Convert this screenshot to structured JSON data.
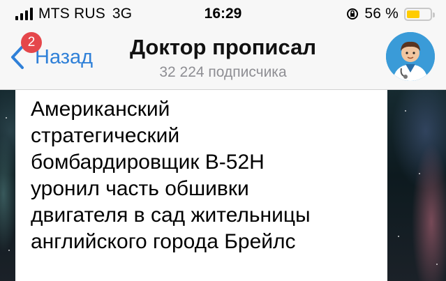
{
  "status_bar": {
    "carrier": "MTS RUS",
    "network": "3G",
    "time": "16:29",
    "battery": "56 %",
    "battery_level": 0.56
  },
  "nav": {
    "back_label": "Назад",
    "unread_badge": "2",
    "channel_title": "Доктор прописал",
    "subscribers": "32 224 подписчика"
  },
  "message": {
    "text": "Американский\nстратегический\nбомбардировщик B-52H\nуронил часть обшивки\nдвигателя в сад жительницы\nанглийского города Брейлс"
  },
  "colors": {
    "accent": "#2f80d8",
    "badge": "#e5474b",
    "battery": "#ffcc00"
  },
  "icons": {
    "back": "chevron-left-icon",
    "orientation_lock": "orientation-lock-icon",
    "battery": "battery-icon",
    "signal": "signal-bars-icon"
  }
}
